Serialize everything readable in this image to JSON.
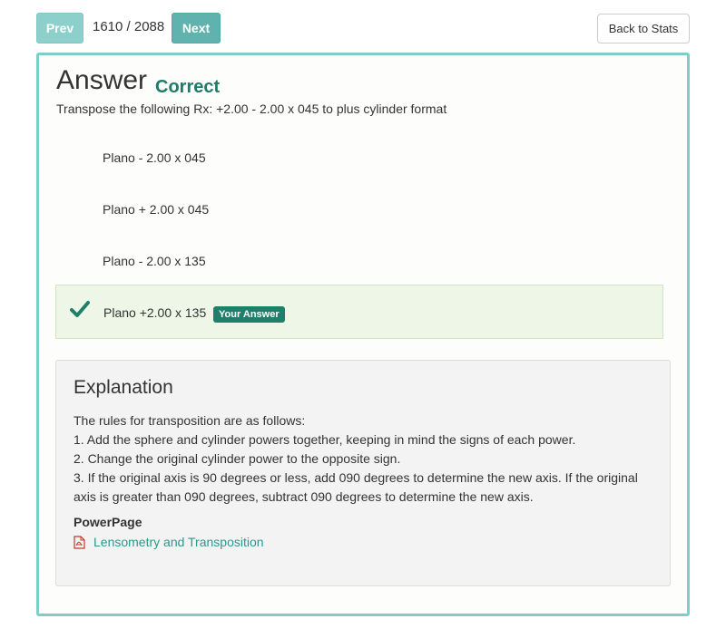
{
  "nav": {
    "prev_label": "Prev",
    "counter": "1610 / 2088",
    "next_label": "Next",
    "back_label": "Back to Stats"
  },
  "answer": {
    "heading": "Answer",
    "status": "Correct",
    "status_color": "#1e7b68",
    "question": "Transpose the following Rx: +2.00 - 2.00 x 045 to plus cylinder format",
    "options": [
      "Plano - 2.00 x 045",
      "Plano + 2.00 x 045",
      "Plano - 2.00 x 135"
    ],
    "selected_option": "Plano +2.00 x 135",
    "your_answer_badge": "Your Answer",
    "selected_icon": "checkmark-icon"
  },
  "explanation": {
    "title": "Explanation",
    "lines": [
      "The rules for transposition are as follows:",
      "1. Add the sphere and cylinder powers together, keeping in mind the signs of each power.",
      "2. Change the original cylinder power to the opposite sign.",
      "3. If the original axis is 90 degrees or less, add 090 degrees to determine the new axis. If the original axis is greater than 090 degrees, subtract 090 degrees to determine the new axis."
    ],
    "powerpage_label": "PowerPage",
    "link_label": "Lensometry and Transposition",
    "link_icon": "pdf-icon"
  },
  "colors": {
    "accent": "#7fcdcb",
    "link": "#2a9a8c",
    "badge": "#1f7f6b"
  }
}
